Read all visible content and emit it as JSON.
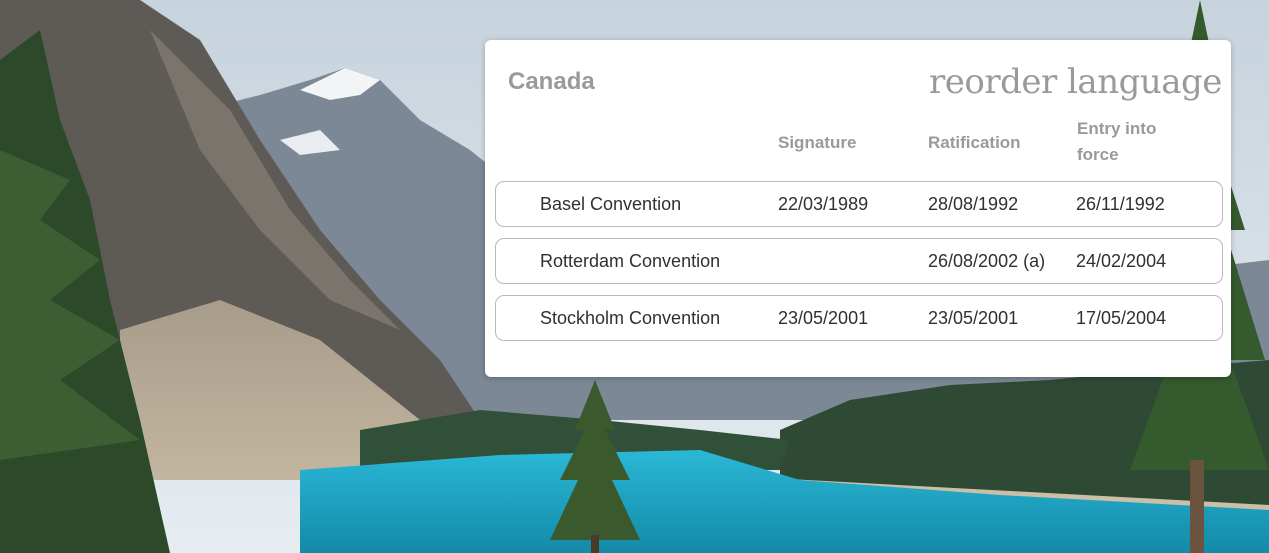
{
  "panel": {
    "country": "Canada",
    "reorder_label": "reorder language",
    "columns": {
      "signature": "Signature",
      "ratification": "Ratification",
      "entry_into_force": "Entry into force"
    },
    "rows": [
      {
        "name": "Basel Convention",
        "signature": "22/03/1989",
        "ratification": "28/08/1992",
        "entry_into_force": "26/11/1992"
      },
      {
        "name": "Rotterdam Convention",
        "signature": "",
        "ratification": "26/08/2002 (a)",
        "entry_into_force": "24/02/2004"
      },
      {
        "name": "Stockholm Convention",
        "signature": "23/05/2001",
        "ratification": "23/05/2001",
        "entry_into_force": "17/05/2004"
      }
    ]
  },
  "colors": {
    "card_bg": "#ffffff",
    "muted_text": "#9a9a9a",
    "row_text": "#303030",
    "row_border": "#b8b8b8",
    "lake": "#1fa8c8"
  }
}
